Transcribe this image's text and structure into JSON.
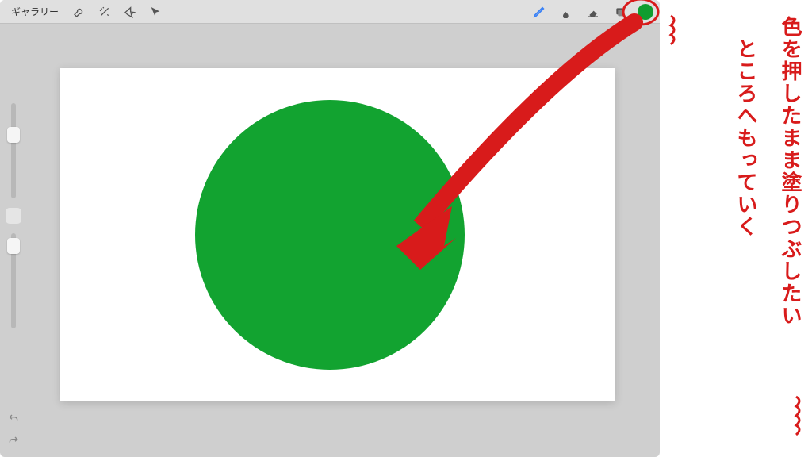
{
  "toolbar": {
    "gallery_label": "ギャラリー",
    "left_tools": [
      {
        "name": "wrench-icon"
      },
      {
        "name": "wand-icon"
      },
      {
        "name": "selection-icon"
      },
      {
        "name": "cursor-icon"
      }
    ],
    "right_tools": [
      {
        "name": "pencil-icon",
        "active": true
      },
      {
        "name": "smudge-icon"
      },
      {
        "name": "eraser-icon"
      },
      {
        "name": "layers-icon"
      }
    ],
    "color_swatch": "#0f9d2f"
  },
  "sidebar": {
    "brush_size_slider": {
      "position_pct": 25
    },
    "opacity_slider": {
      "position_pct": 5
    }
  },
  "canvas": {
    "shape": "circle",
    "shape_color": "#12a330"
  },
  "annotation": {
    "line1": "色を押したまま塗りつぶしたい",
    "line2": "ところへもっていく",
    "highlight_circle_color": "#d81b1b",
    "arrow_color": "#d81b1b"
  }
}
